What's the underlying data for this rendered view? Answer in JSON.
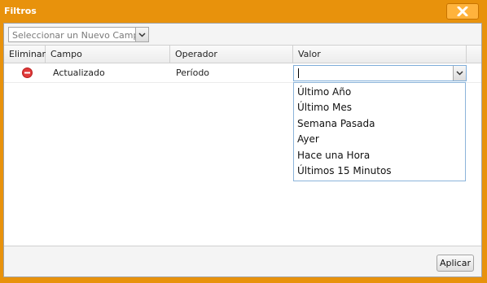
{
  "window": {
    "title": "Filtros"
  },
  "toolbar": {
    "field_select": {
      "placeholder": "Seleccionar un Nuevo Campo"
    }
  },
  "grid": {
    "columns": [
      "Eliminar",
      "Campo",
      "Operador",
      "Valor"
    ],
    "rows": [
      {
        "campo": "Actualizado",
        "operador": "Período",
        "valor": ""
      }
    ]
  },
  "value_dropdown": {
    "options": [
      "Último Año",
      "Último Mes",
      "Semana Pasada",
      "Ayer",
      "Hace una Hora",
      "Últimos 15 Minutos"
    ]
  },
  "footer": {
    "apply_label": "Aplicar"
  },
  "colors": {
    "window_frame": "#e8920c",
    "delete_icon": "#e03a3a",
    "focus_border": "#7eadd9"
  },
  "icons": {
    "close": "close-icon",
    "delete": "delete-icon",
    "dropdown": "chevron-down-icon"
  }
}
